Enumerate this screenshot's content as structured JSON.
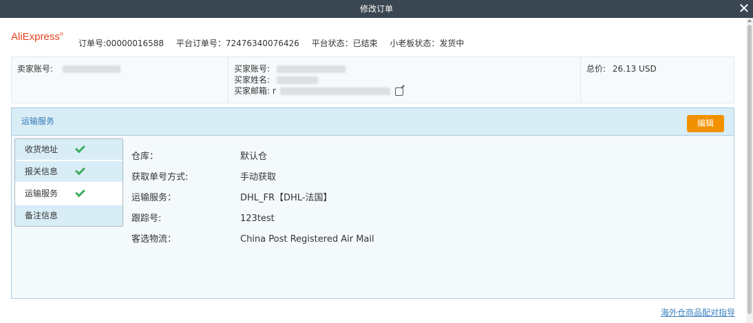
{
  "window": {
    "title": "修改订单"
  },
  "brand": {
    "logo_ali": "Ali",
    "logo_express": "Express",
    "logo_reg": "®"
  },
  "order": {
    "order_no": "订单号:00000016588",
    "platform_order_no": "平台订单号：72476340076426",
    "platform_status": "平台状态：已结束",
    "small_board_status": "小老板状态：发货中"
  },
  "info": {
    "seller_label": "卖家账号:",
    "buyer_account_label": "买家账号:",
    "buyer_name_label": "买家姓名:",
    "buyer_email_label": "买家邮箱:",
    "buyer_email_prefix": "r",
    "total_label": "总价:",
    "total_value": "26.13 USD"
  },
  "shipping": {
    "title": "运输服务",
    "edit_label": "编辑",
    "tabs": [
      {
        "label": "收货地址",
        "checked": true
      },
      {
        "label": "报关信息",
        "checked": true
      },
      {
        "label": "运输服务",
        "checked": true
      },
      {
        "label": "备注信息",
        "checked": false
      }
    ],
    "fields": [
      {
        "label": "仓库：",
        "value": "默认仓"
      },
      {
        "label": "获取单号方式:",
        "value": "手动获取"
      },
      {
        "label": "运输服务：",
        "value": "DHL_FR【DHL-法国】"
      },
      {
        "label": "跟踪号:",
        "value": "123test"
      },
      {
        "label": "客选物流：",
        "value": "China Post Registered Air Mail"
      }
    ]
  },
  "footer": {
    "guide_link": "海外仓商品配对指导"
  },
  "colors": {
    "titlebar": "#3a4651",
    "edit_button": "#f29100",
    "header_bg": "#d9edf7",
    "check": "#3dae5b",
    "link": "#3a7fc0"
  }
}
